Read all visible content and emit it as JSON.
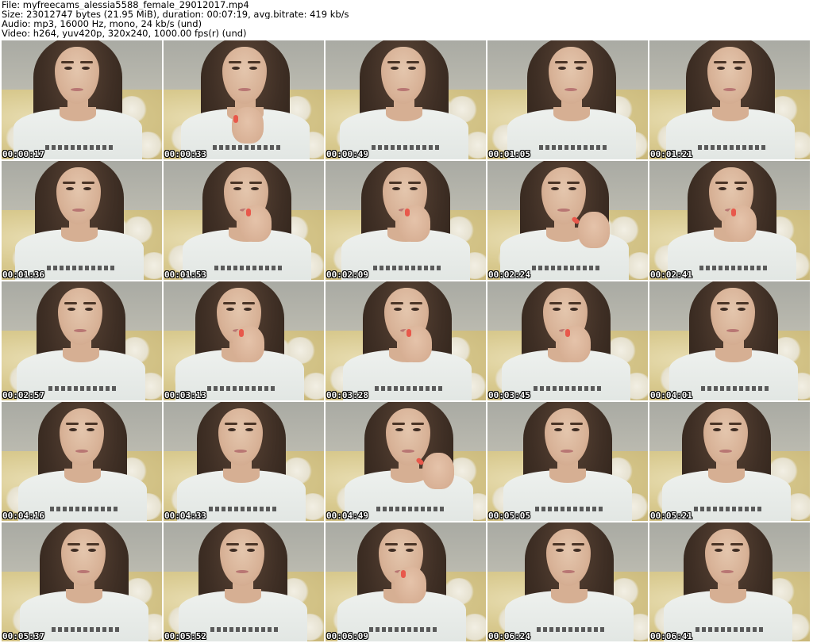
{
  "header": {
    "file_line": "File: myfreecams_alessia5588_female_29012017.mp4",
    "size_line": "Size: 23012747 bytes (21.95 MiB), duration: 00:07:19, avg.bitrate: 419 kb/s",
    "audio_line": "Audio: mp3, 16000 Hz, mono, 24 kb/s (und)",
    "video_line": "Video: h264, yuv420p, 320x240, 1000.00 fps(r) (und)"
  },
  "thumbnails": [
    {
      "timestamp": "00:00:17",
      "pose": "neutral"
    },
    {
      "timestamp": "00:00:33",
      "pose": "hand-low"
    },
    {
      "timestamp": "00:00:49",
      "pose": "neutral"
    },
    {
      "timestamp": "00:01:05",
      "pose": "neutral"
    },
    {
      "timestamp": "00:01:21",
      "pose": "neutral"
    },
    {
      "timestamp": "00:01:36",
      "pose": "neutral"
    },
    {
      "timestamp": "00:01:53",
      "pose": "hand-mouth"
    },
    {
      "timestamp": "00:02:09",
      "pose": "hand-mouth"
    },
    {
      "timestamp": "00:02:24",
      "pose": "hand-side"
    },
    {
      "timestamp": "00:02:41",
      "pose": "hand-mouth"
    },
    {
      "timestamp": "00:02:57",
      "pose": "neutral"
    },
    {
      "timestamp": "00:03:13",
      "pose": "hand-mouth"
    },
    {
      "timestamp": "00:03:28",
      "pose": "hand-mouth"
    },
    {
      "timestamp": "00:03:45",
      "pose": "hand-mouth"
    },
    {
      "timestamp": "00:04:01",
      "pose": "neutral"
    },
    {
      "timestamp": "00:04:16",
      "pose": "neutral"
    },
    {
      "timestamp": "00:04:33",
      "pose": "neutral"
    },
    {
      "timestamp": "00:04:49",
      "pose": "hand-side"
    },
    {
      "timestamp": "00:05:05",
      "pose": "neutral"
    },
    {
      "timestamp": "00:05:21",
      "pose": "neutral"
    },
    {
      "timestamp": "00:05:37",
      "pose": "neutral"
    },
    {
      "timestamp": "00:05:52",
      "pose": "neutral"
    },
    {
      "timestamp": "00:06:09",
      "pose": "hand-mouth"
    },
    {
      "timestamp": "00:06:24",
      "pose": "neutral"
    },
    {
      "timestamp": "00:06:41",
      "pose": "neutral"
    }
  ],
  "colors": {
    "background": "#ffffff",
    "timestamp_text": "#ffffff",
    "timestamp_outline": "#000000",
    "header_text": "#000000"
  }
}
